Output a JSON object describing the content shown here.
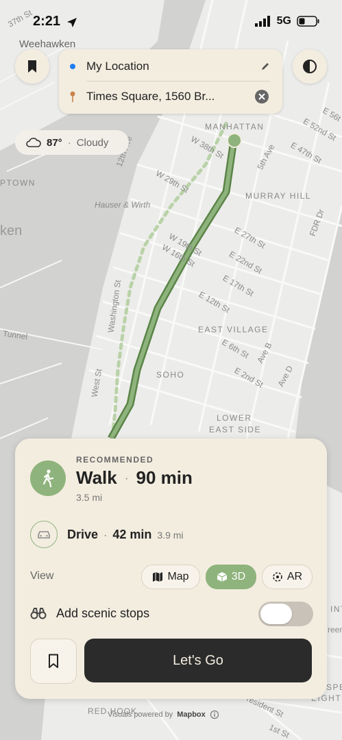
{
  "status": {
    "time": "2:21",
    "network": "5G"
  },
  "map_labels": {
    "weehawken": "Weehawken",
    "manhattan": "MANHATTAN",
    "murray_hill": "MURRAY HILL",
    "east_village": "EAST VILLAGE",
    "soho": "SOHO",
    "lower": "LOWER",
    "east_side": "EAST SIDE",
    "uptown": "PTOWN",
    "ken": "ken",
    "hauser": "Hauser & Wirth",
    "tunnel": "Tunnel",
    "red_hook": "RED HOOK",
    "st37": "37th St",
    "e56": "E 56t",
    "e52": "E 52nd St",
    "e47": "E 47th St",
    "w38": "W 38th St",
    "fifth_ave": "5th Ave",
    "twelfth_ave": "12th Ave",
    "w29": "W 29th St",
    "fdr": "FDR Dr",
    "e27": "E 27th St",
    "w19": "W 19th St",
    "w16": "W 16th St",
    "e22": "E 22nd St",
    "e17": "E 17th St",
    "washington": "Washington St",
    "e12": "E 12th St",
    "e6": "E 6th St",
    "ave_b": "Ave B",
    "ave_d": "Ave D",
    "e2": "E 2nd St",
    "west_st": "West St",
    "int": "INT",
    "spe": "SPE",
    "eight": "EIGHT",
    "resident": "resident St",
    "first_st": "1st St",
    "green": "reen"
  },
  "search": {
    "origin": "My Location",
    "destination": "Times Square, 1560 Br..."
  },
  "weather": {
    "temp": "87°",
    "separator": "·",
    "condition": "Cloudy"
  },
  "route_panel": {
    "recommended_label": "RECOMMENDED",
    "walk_mode": "Walk",
    "separator": "·",
    "walk_time": "90 min",
    "walk_distance": "3.5 mi",
    "drive_mode": "Drive",
    "drive_time": "42 min",
    "drive_distance": "3.9 mi",
    "view_label": "View",
    "view_options": {
      "map": "Map",
      "three_d": "3D",
      "ar": "AR"
    },
    "selected_view": "3D",
    "scenic_label": "Add scenic stops",
    "scenic_enabled": false,
    "go_label": "Let's Go"
  },
  "attribution": {
    "text": "Visuals powered by",
    "brand": "Mapbox"
  },
  "colors": {
    "accent_green": "#8fb37c",
    "route_green": "#6e9a5a",
    "panel_bg": "#f3ede0",
    "go_button": "#2b2b2b"
  },
  "icons": [
    "location-arrow-icon",
    "signal-icon",
    "battery-icon",
    "bookmark-icon",
    "contrast-icon",
    "location-dot-icon",
    "destination-pin-icon",
    "edit-pencil-icon",
    "clear-x-icon",
    "cloud-icon",
    "walk-icon",
    "car-icon",
    "map-icon",
    "cube-icon",
    "ar-icon",
    "binoculars-icon",
    "info-icon"
  ]
}
